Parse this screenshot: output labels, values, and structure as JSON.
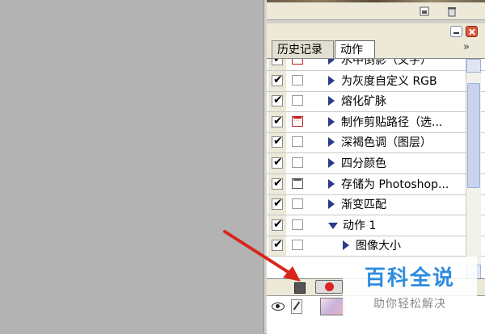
{
  "tabs": [
    {
      "label": "历史记录"
    },
    {
      "label": "动作"
    }
  ],
  "panel_menu_glyph": "»",
  "actions": [
    {
      "label": "水中倒影（文字）",
      "checked": true,
      "dialog": "red",
      "level": 0
    },
    {
      "label": "为灰度自定义 RGB",
      "checked": true,
      "dialog": "none",
      "level": 0
    },
    {
      "label": "熔化矿脉",
      "checked": true,
      "dialog": "none",
      "level": 0
    },
    {
      "label": "制作剪贴路径（选...",
      "checked": true,
      "dialog": "red",
      "level": 0
    },
    {
      "label": "深褐色调（图层）",
      "checked": true,
      "dialog": "none",
      "level": 0
    },
    {
      "label": "四分颜色",
      "checked": true,
      "dialog": "none",
      "level": 0
    },
    {
      "label": "存储为 Photoshop...",
      "checked": true,
      "dialog": "gray",
      "level": 0
    },
    {
      "label": "渐变匹配",
      "checked": true,
      "dialog": "none",
      "level": 0
    },
    {
      "label": "动作 1",
      "checked": true,
      "dialog": "none",
      "level": 0,
      "expanded": true
    },
    {
      "label": "图像大小",
      "checked": true,
      "dialog": "none",
      "level": 1
    }
  ],
  "watermark": {
    "main": "百科全说",
    "sub": "助你轻松解决"
  },
  "colors": {
    "accent_arrow": "#d8261b",
    "tri": "#2b3a8a",
    "record": "#dd2222"
  }
}
